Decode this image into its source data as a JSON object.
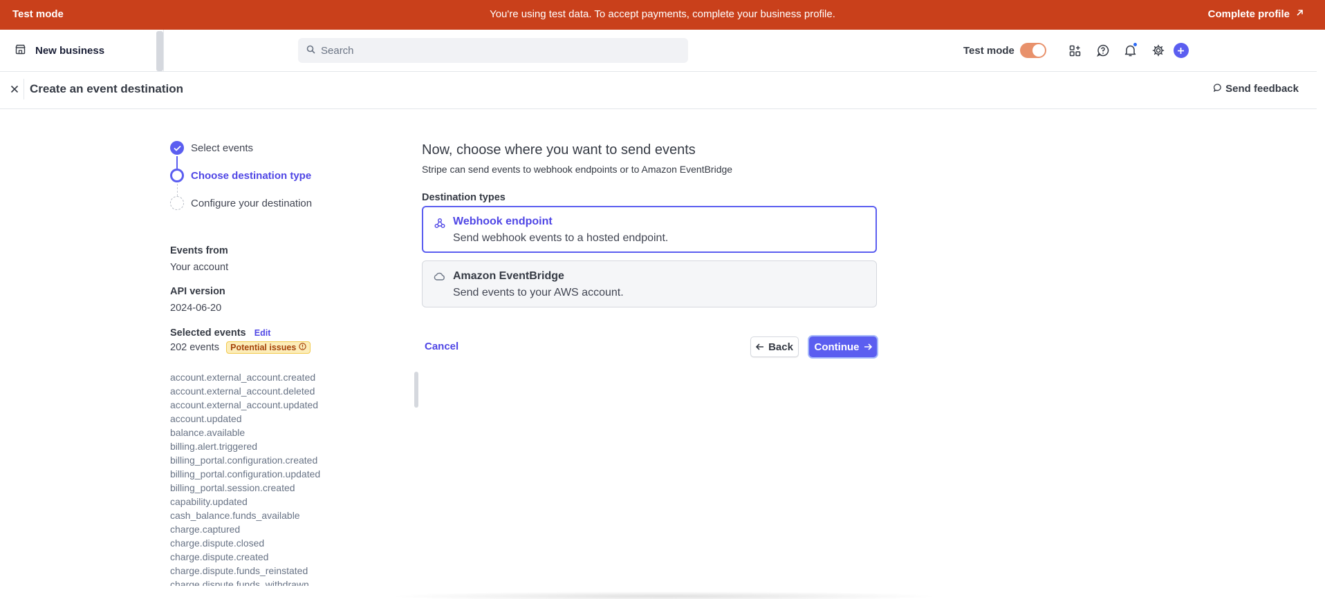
{
  "banner": {
    "mode_label": "Test mode",
    "message": "You're using test data. To accept payments, complete your business profile.",
    "cta": "Complete profile"
  },
  "sidebar": {
    "account_name": "New business"
  },
  "search": {
    "placeholder": "Search"
  },
  "topbar": {
    "test_mode_label": "Test mode",
    "test_mode_on": true
  },
  "header": {
    "title": "Create an event destination",
    "feedback": "Send feedback"
  },
  "steps": [
    {
      "label": "Select events",
      "state": "done"
    },
    {
      "label": "Choose destination type",
      "state": "active"
    },
    {
      "label": "Configure your destination",
      "state": "todo"
    }
  ],
  "summary": {
    "events_from_label": "Events from",
    "events_from_value": "Your account",
    "api_version_label": "API version",
    "api_version_value": "2024-06-20",
    "selected_events_label": "Selected events",
    "edit_label": "Edit",
    "events_count": "202 events",
    "issues_badge": "Potential issues"
  },
  "events": [
    "account.external_account.created",
    "account.external_account.deleted",
    "account.external_account.updated",
    "account.updated",
    "balance.available",
    "billing.alert.triggered",
    "billing_portal.configuration.created",
    "billing_portal.configuration.updated",
    "billing_portal.session.created",
    "capability.updated",
    "cash_balance.funds_available",
    "charge.captured",
    "charge.dispute.closed",
    "charge.dispute.created",
    "charge.dispute.funds_reinstated",
    "charge.dispute.funds_withdrawn"
  ],
  "main": {
    "title": "Now, choose where you want to send events",
    "subtitle": "Stripe can send events to webhook endpoints or to Amazon EventBridge",
    "destination_types_label": "Destination types",
    "options": [
      {
        "title": "Webhook endpoint",
        "description": "Send webhook events to a hosted endpoint.",
        "selected": true
      },
      {
        "title": "Amazon EventBridge",
        "description": "Send events to your AWS account.",
        "selected": false
      }
    ],
    "cancel": "Cancel",
    "back": "Back",
    "continue": "Continue"
  },
  "colors": {
    "banner": "#c9401b",
    "accent": "#5b5ef0",
    "link": "#4f46e5",
    "badge_bg": "#fcedb9"
  }
}
